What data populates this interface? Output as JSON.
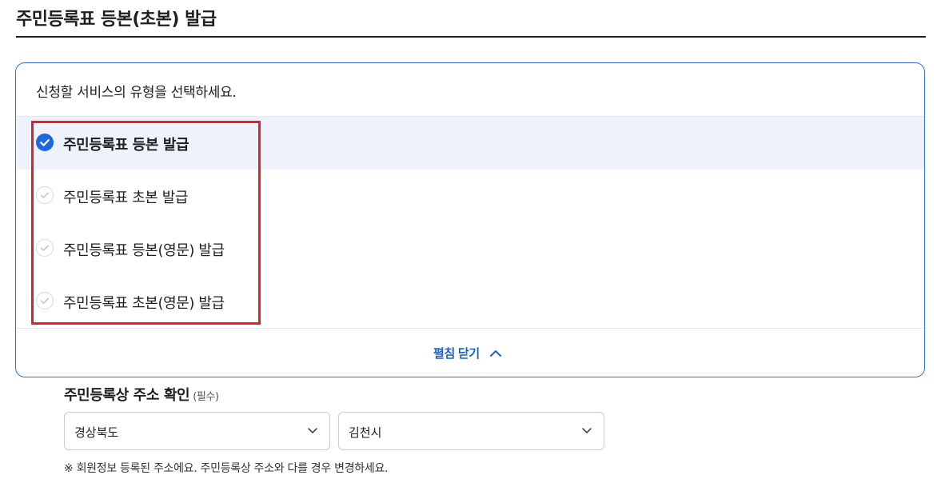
{
  "page": {
    "title": "주민등록표 등본(초본) 발급"
  },
  "service_panel": {
    "prompt": "신청할 서비스의 유형을 선택하세요.",
    "options": [
      {
        "label": "주민등록표 등본 발급",
        "selected": true
      },
      {
        "label": "주민등록표 초본 발급",
        "selected": false
      },
      {
        "label": "주민등록표 등본(영문) 발급",
        "selected": false
      },
      {
        "label": "주민등록표 초본(영문) 발급",
        "selected": false
      }
    ],
    "collapse_label": "펼침 닫기"
  },
  "address": {
    "heading": "주민등록상 주소 확인",
    "required": "(필수)",
    "province": "경상북도",
    "city": "김천시",
    "notice": "※ 회원정보 등록된 주소에요. 주민등록상 주소와 다를 경우 변경하세요."
  },
  "colors": {
    "accent": "#1b68e0",
    "link": "#1b5fc9",
    "highlight": "#e0202a",
    "selected_bg": "#eef3fb",
    "panel_border": "#2f6fd1"
  },
  "icons": {
    "selected_check": "check-circle-filled-icon",
    "unselected_check": "check-circle-outline-icon",
    "collapse": "chevron-up-icon",
    "dropdown": "chevron-down-icon"
  }
}
